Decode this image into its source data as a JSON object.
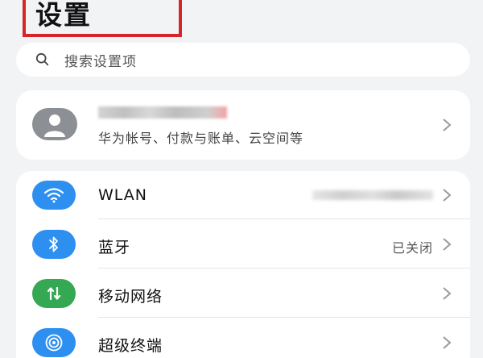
{
  "header": {
    "title": "设置"
  },
  "search": {
    "placeholder": "搜索设置项",
    "icon": "search-icon"
  },
  "account": {
    "icon": "avatar-icon",
    "subtitle": "华为帐号、付款与账单、云空间等"
  },
  "settings": [
    {
      "label": "WLAN",
      "icon": "wifi-icon",
      "color": "#2d8ff0"
    },
    {
      "label": "蓝牙",
      "value": "已关闭",
      "icon": "bluetooth-icon",
      "color": "#2d8ff0"
    },
    {
      "label": "移动网络",
      "icon": "mobile-network-icon",
      "color": "#34a853"
    },
    {
      "label": "超级终端",
      "icon": "super-device-icon",
      "color": "#2d8ff0"
    }
  ]
}
